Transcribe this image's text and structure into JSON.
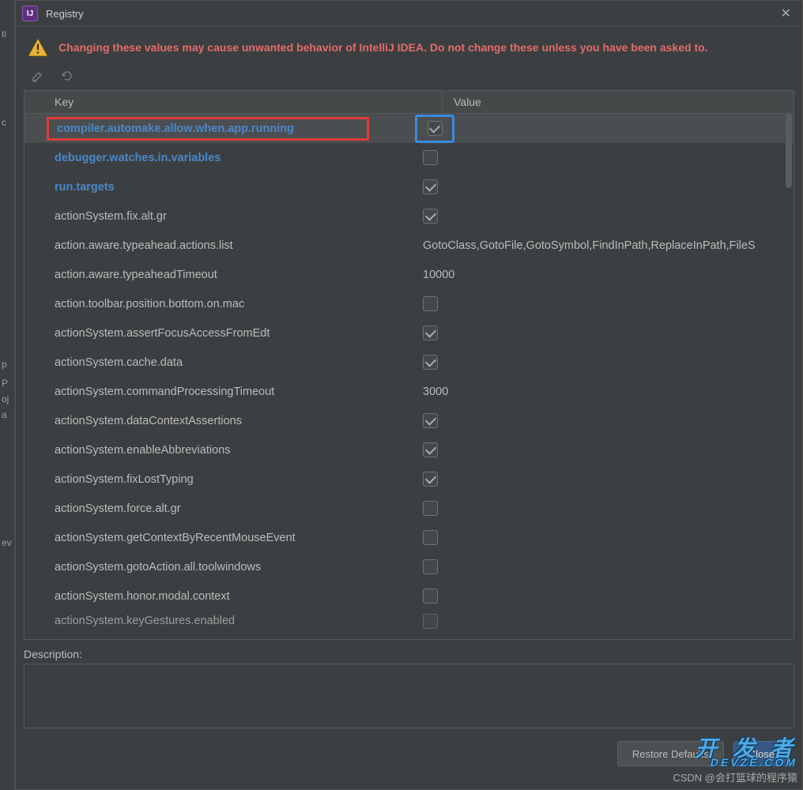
{
  "window": {
    "title": "Registry"
  },
  "warning": "Changing these values may cause unwanted behavior of IntelliJ IDEA. Do not change these unless you have been asked to.",
  "columns": {
    "key": "Key",
    "value": "Value"
  },
  "rows": [
    {
      "key": "compiler.automake.allow.when.app.running",
      "type": "check",
      "checked": true,
      "link": true,
      "selected": true,
      "hl_key": "red",
      "hl_val": "blue"
    },
    {
      "key": "debugger.watches.in.variables",
      "type": "check",
      "checked": false,
      "link": true
    },
    {
      "key": "run.targets",
      "type": "check",
      "checked": true,
      "link": true
    },
    {
      "key": "actionSystem.fix.alt.gr",
      "type": "check",
      "checked": true
    },
    {
      "key": "action.aware.typeahead.actions.list",
      "type": "text",
      "value": "GotoClass,GotoFile,GotoSymbol,FindInPath,ReplaceInPath,FileS"
    },
    {
      "key": "action.aware.typeaheadTimeout",
      "type": "text",
      "value": "10000"
    },
    {
      "key": "action.toolbar.position.bottom.on.mac",
      "type": "check",
      "checked": false
    },
    {
      "key": "actionSystem.assertFocusAccessFromEdt",
      "type": "check",
      "checked": true
    },
    {
      "key": "actionSystem.cache.data",
      "type": "check",
      "checked": true
    },
    {
      "key": "actionSystem.commandProcessingTimeout",
      "type": "text",
      "value": "3000"
    },
    {
      "key": "actionSystem.dataContextAssertions",
      "type": "check",
      "checked": true
    },
    {
      "key": "actionSystem.enableAbbreviations",
      "type": "check",
      "checked": true
    },
    {
      "key": "actionSystem.fixLostTyping",
      "type": "check",
      "checked": true
    },
    {
      "key": "actionSystem.force.alt.gr",
      "type": "check",
      "checked": false
    },
    {
      "key": "actionSystem.getContextByRecentMouseEvent",
      "type": "check",
      "checked": false
    },
    {
      "key": "actionSystem.gotoAction.all.toolwindows",
      "type": "check",
      "checked": false
    },
    {
      "key": "actionSystem.honor.modal.context",
      "type": "check",
      "checked": false
    },
    {
      "key": "actionSystem.keyGestures.enabled",
      "type": "check",
      "checked": false,
      "cutoff": true
    }
  ],
  "description_label": "Description:",
  "buttons": {
    "restore": "Restore Defaults",
    "close": "Close"
  },
  "watermark": {
    "line1_cn": "开 发 者",
    "line1_en": "DEVZE.COM",
    "line2": "CSDN @会打篮球的程序猿"
  },
  "left_fragments": {
    "f1": "ti",
    "f2": "c",
    "f3": "p",
    "f4": "P",
    "f5": "oj",
    "f6": "a",
    "f7": "ev"
  }
}
